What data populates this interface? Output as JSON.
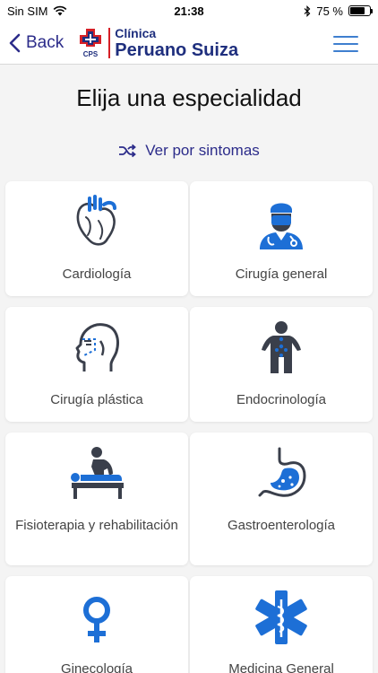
{
  "status_bar": {
    "carrier": "Sin SIM",
    "time": "21:38",
    "battery_percent": "75 %",
    "battery_level": 0.75
  },
  "nav": {
    "back_label": "Back",
    "logo_line1": "Clínica",
    "logo_line2": "Peruano Suiza",
    "logo_badge": "CPS"
  },
  "page": {
    "title": "Elija una especialidad",
    "symptoms_link": "Ver por sintomas"
  },
  "colors": {
    "accent_navy": "#2c2c8a",
    "icon_blue": "#1d6fd6",
    "icon_dark": "#3a3f4b",
    "brand_red": "#d61f26"
  },
  "specialties": [
    {
      "label": "Cardiología",
      "icon": "heart-icon"
    },
    {
      "label": "Cirugía general",
      "icon": "surgeon-icon"
    },
    {
      "label": "Cirugía plástica",
      "icon": "face-profile-icon"
    },
    {
      "label": "Endocrinología",
      "icon": "body-glands-icon"
    },
    {
      "label": "Fisioterapia y rehabilitación",
      "icon": "massage-icon"
    },
    {
      "label": "Gastroenterología",
      "icon": "stomach-icon"
    },
    {
      "label": "Ginecología",
      "icon": "female-symbol-icon"
    },
    {
      "label": "Medicina General",
      "icon": "star-of-life-icon"
    }
  ]
}
